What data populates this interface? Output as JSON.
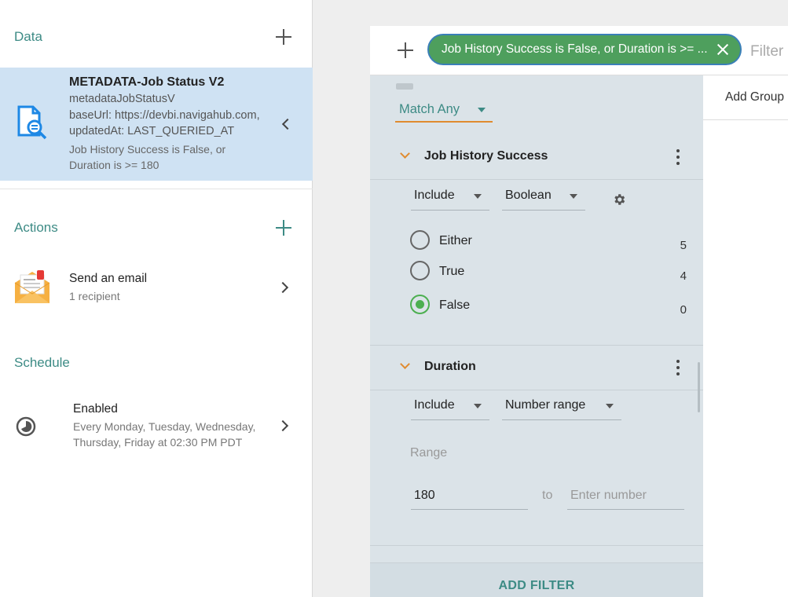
{
  "left": {
    "data_section": {
      "title": "Data",
      "card": {
        "title": "METADATA-Job Status V2",
        "subtitle": "metadataJobStatusV",
        "line1": "baseUrl: https://devbi.navigahub.com,",
        "line2": "updatedAt: LAST_QUERIED_AT",
        "filter_line1": "Job History Success is False, or",
        "filter_line2": "Duration is >= 180"
      }
    },
    "actions_section": {
      "title": "Actions",
      "item": {
        "title": "Send an email",
        "subtitle": "1 recipient"
      }
    },
    "schedule_section": {
      "title": "Schedule",
      "item": {
        "title": "Enabled",
        "line1": "Every Monday, Tuesday, Wednesday,",
        "line2": "Thursday, Friday at 02:30 PM PDT"
      }
    }
  },
  "filter_bar": {
    "chip_label": "Job History Success is False, or Duration is >= ...",
    "hint": "Filter"
  },
  "panel": {
    "match_label": "Match Any",
    "groups": [
      {
        "title": "Job History Success",
        "include_label": "Include",
        "type_label": "Boolean",
        "options": [
          {
            "label": "Either",
            "count": "5",
            "selected": false
          },
          {
            "label": "True",
            "count": "4",
            "selected": false
          },
          {
            "label": "False",
            "count": "0",
            "selected": true
          }
        ]
      },
      {
        "title": "Duration",
        "include_label": "Include",
        "type_label": "Number range",
        "range_label": "Range",
        "from_value": "180",
        "to_label": "to",
        "to_placeholder": "Enter number"
      }
    ],
    "add_filter_label": "ADD FILTER"
  },
  "right_column": {
    "add_group_label": "Add Group"
  },
  "colors": {
    "accent": "#3d8b85",
    "chip": "#4e9f5d",
    "orange": "#e08b2f",
    "selected_card": "#cfe2f3"
  }
}
